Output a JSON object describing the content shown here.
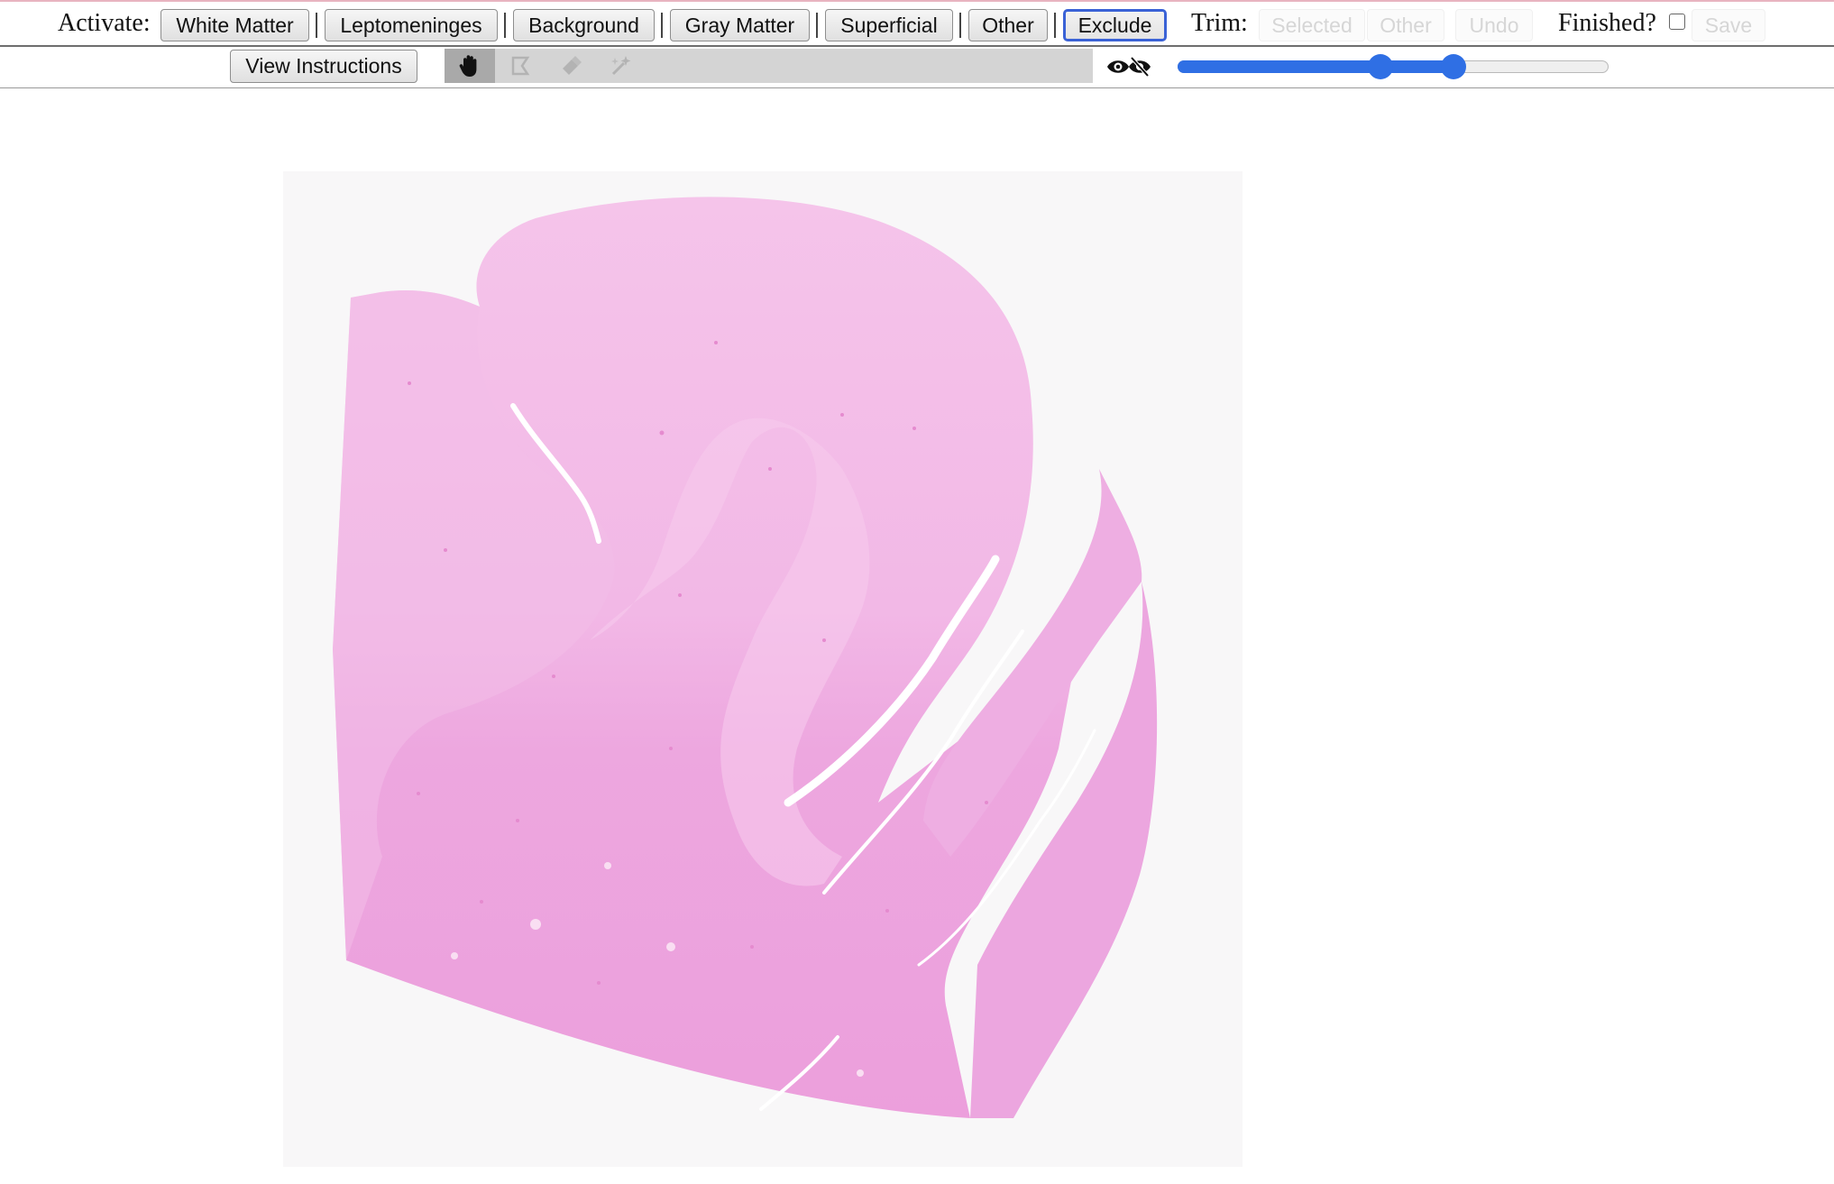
{
  "toolbar": {
    "activate_label": "Activate:",
    "activate_buttons": [
      "White Matter",
      "Leptomeninges",
      "Background",
      "Gray Matter",
      "Superficial",
      "Other",
      "Exclude"
    ],
    "active_button": "Exclude",
    "trim_label": "Trim:",
    "trim_buttons": [
      "Selected",
      "Other",
      "Undo"
    ],
    "finished_label": "Finished?",
    "finished_checked": false,
    "save_label": "Save"
  },
  "toolbar2": {
    "view_instructions_label": "View Instructions",
    "tools": [
      "hand-icon",
      "polygon-select-icon",
      "brush-icon",
      "wand-icon"
    ],
    "active_tool": "hand-icon",
    "visibility_icon": "eye-toggle-icon",
    "opacity_slider": {
      "lower": 0.47,
      "upper": 0.64
    }
  },
  "colors": {
    "accent": "#2f6fe4",
    "active_border": "#3a62d6",
    "tissue_pink": "#f0b4e2",
    "tissue_deep": "#ea9fdc"
  },
  "viewer": {
    "image": "brain-tissue-section"
  }
}
